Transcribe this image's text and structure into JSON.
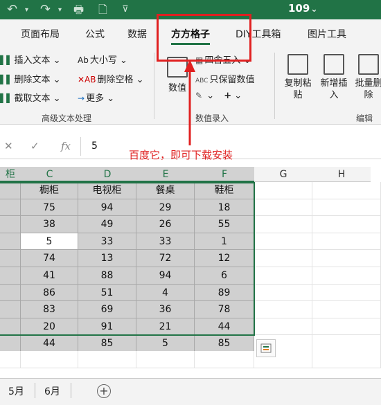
{
  "titlebar": {
    "filename": "109",
    "dropdown": "⌄"
  },
  "tabs": [
    "页面布局",
    "公式",
    "数据",
    "方方格子",
    "DIY工具箱",
    "图片工具"
  ],
  "ribbon": {
    "text_group": {
      "insert": "插入文本",
      "delete": "删除文本",
      "extract": "截取文本",
      "case": "大小写",
      "delete_space": "删除空格",
      "more": "更多",
      "label": "高级文本处理"
    },
    "num_group": {
      "numvalue": "数值",
      "round": "四舍五入",
      "keep_num": "只保留数值",
      "label": "数值录入"
    },
    "edit_group": {
      "copy_paste": "复制粘贴",
      "new_insert": "新增插入",
      "batch_delete": "批量删除",
      "label": "编辑"
    }
  },
  "formula_bar": {
    "value": "5",
    "fx": "fx"
  },
  "annotation": "百度它，即可下载安装",
  "columns": [
    "柜",
    "C",
    "D",
    "E",
    "F",
    "G",
    "H"
  ],
  "table": {
    "headers": [
      "",
      "橱柜",
      "电视柜",
      "餐桌",
      "鞋柜"
    ],
    "rows": [
      [
        "75",
        "94",
        "29",
        "18"
      ],
      [
        "38",
        "49",
        "26",
        "55"
      ],
      [
        "5",
        "33",
        "33",
        "1"
      ],
      [
        "74",
        "13",
        "72",
        "12"
      ],
      [
        "41",
        "88",
        "94",
        "6"
      ],
      [
        "86",
        "51",
        "4",
        "89"
      ],
      [
        "83",
        "69",
        "36",
        "78"
      ],
      [
        "20",
        "91",
        "21",
        "44"
      ],
      [
        "44",
        "85",
        "5",
        "85"
      ]
    ]
  },
  "sheets": [
    "5月",
    "6月"
  ],
  "colors": {
    "excel_green": "#217346",
    "annotation_red": "#e02020",
    "selection_gray": "#d0d0d0"
  }
}
